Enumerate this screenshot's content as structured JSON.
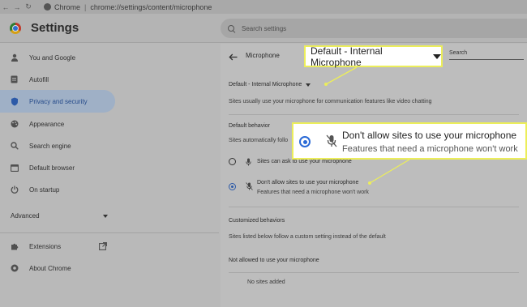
{
  "browser": {
    "url_site": "Chrome",
    "url_path": "chrome://settings/content/microphone"
  },
  "header": {
    "title": "Settings",
    "search_placeholder": "Search settings"
  },
  "sidebar": {
    "items": [
      {
        "label": "You and Google",
        "icon": "person-icon"
      },
      {
        "label": "Autofill",
        "icon": "autofill-icon"
      },
      {
        "label": "Privacy and security",
        "icon": "shield-icon",
        "active": true
      },
      {
        "label": "Appearance",
        "icon": "palette-icon"
      },
      {
        "label": "Search engine",
        "icon": "search-icon"
      },
      {
        "label": "Default browser",
        "icon": "browser-icon"
      },
      {
        "label": "On startup",
        "icon": "power-icon"
      }
    ],
    "advanced_label": "Advanced",
    "extensions_label": "Extensions",
    "about_label": "About Chrome"
  },
  "main": {
    "page_title": "Microphone",
    "search_label": "Search",
    "device_select": "Default - Internal Microphone",
    "usage_note": "Sites usually use your microphone for communication features like video chatting",
    "default_behavior_heading": "Default behavior",
    "default_behavior_note": "Sites automatically follo",
    "option_allow": "Sites can ask to use your microphone",
    "option_block_title": "Don't allow sites to use your microphone",
    "option_block_sub": "Features that need a microphone won't work",
    "customized_heading": "Customized behaviors",
    "customized_note": "Sites listed below follow a custom setting instead of the default",
    "not_allowed_heading": "Not allowed to use your microphone",
    "no_sites": "No sites added"
  },
  "callouts": {
    "dropdown_text": "Default - Internal Microphone",
    "radio_title": "Don't allow sites to use your microphone",
    "radio_sub": "Features that need a microphone won't work"
  },
  "colors": {
    "accent": "#2c5aa8",
    "highlight_border": "#ecee5a"
  }
}
